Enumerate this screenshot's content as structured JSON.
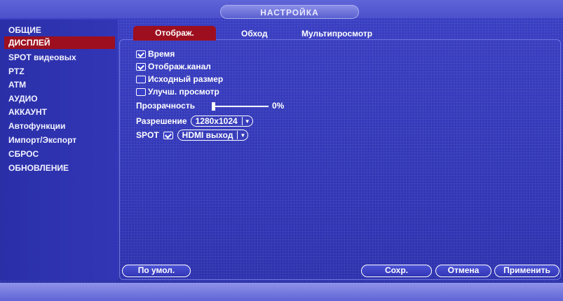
{
  "header": {
    "title": "НАСТРОЙКА"
  },
  "sidebar": {
    "items": [
      {
        "label": "ОБЩИЕ"
      },
      {
        "label": "ДИСПЛЕЙ"
      },
      {
        "label": "SPOT видеовых"
      },
      {
        "label": "PTZ"
      },
      {
        "label": "ATM"
      },
      {
        "label": "АУДИО"
      },
      {
        "label": "АККАУНТ"
      },
      {
        "label": "Автофункции"
      },
      {
        "label": "Импорт/Экспорт"
      },
      {
        "label": "СБРОС"
      },
      {
        "label": "ОБНОВЛЕНИЕ"
      }
    ]
  },
  "tabs": [
    {
      "label": "Отображ."
    },
    {
      "label": "Обход"
    },
    {
      "label": "Мультипросмотр"
    }
  ],
  "display": {
    "time": {
      "label": "Время",
      "checked": true
    },
    "channel": {
      "label": "Отображ.канал",
      "checked": true
    },
    "original_size": {
      "label": "Исходный размер",
      "checked": false
    },
    "enhanced": {
      "label": "Улучш. просмотр",
      "checked": false
    },
    "transparency": {
      "label": "Прозрачность",
      "value": "0%"
    },
    "resolution": {
      "label": "Разрешение",
      "value": "1280x1024"
    },
    "spot": {
      "label": "SPOT",
      "checked": true,
      "value": "HDMI выход"
    }
  },
  "buttons": {
    "default": "По умол.",
    "save": "Сохр.",
    "cancel": "Отмена",
    "apply": "Применить"
  }
}
